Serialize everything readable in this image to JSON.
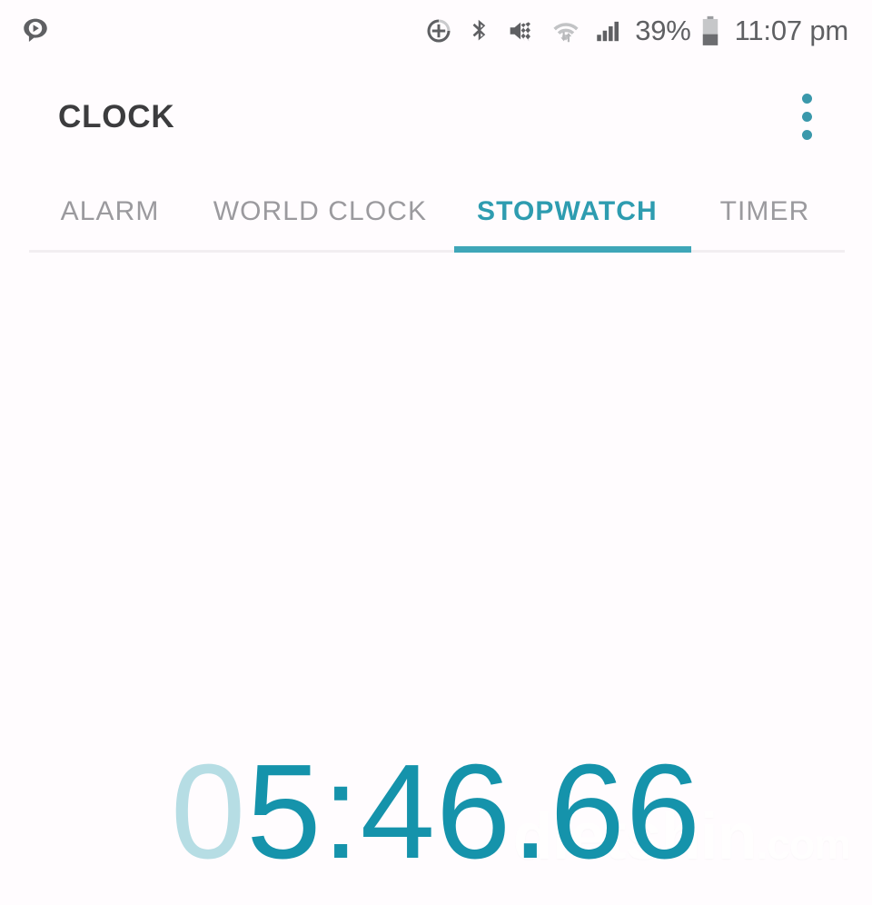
{
  "status_bar": {
    "notification_icons": [
      {
        "name": "message-play-icon",
        "label": "media message notification"
      }
    ],
    "system_icons": [
      {
        "name": "power-saving-icon",
        "label": "power saving mode"
      },
      {
        "name": "bluetooth-icon",
        "label": "Bluetooth"
      },
      {
        "name": "mute-vibrate-icon",
        "label": "sound muted with vibrate"
      },
      {
        "name": "wifi-icon",
        "label": "Wi-Fi connected with data transfer"
      },
      {
        "name": "signal-icon",
        "label": "mobile signal strength"
      }
    ],
    "battery_percent": "39%",
    "time": "11:07 pm"
  },
  "app_bar": {
    "title": "CLOCK",
    "overflow_menu_label": "More options"
  },
  "tabs": [
    {
      "label": "ALARM",
      "active": false
    },
    {
      "label": "WORLD CLOCK",
      "active": false
    },
    {
      "label": "STOPWATCH",
      "active": true
    },
    {
      "label": "TIMER",
      "active": false
    }
  ],
  "stopwatch": {
    "elapsed": "05:46.66",
    "leading_dim": "0",
    "remainder": "5:46.66"
  },
  "watermark": {
    "name": "dietshin",
    "tld": ".com"
  },
  "colors": {
    "accent_teal": "#1593ab",
    "tab_active": "#2e9cb0",
    "tab_indicator": "#3fa6b8",
    "tab_inactive": "#9b9a9e",
    "title": "#3c3c3e",
    "status_icon": "#5f6063",
    "dim_digit": "#b6dde4",
    "background": "#fffcfe"
  }
}
